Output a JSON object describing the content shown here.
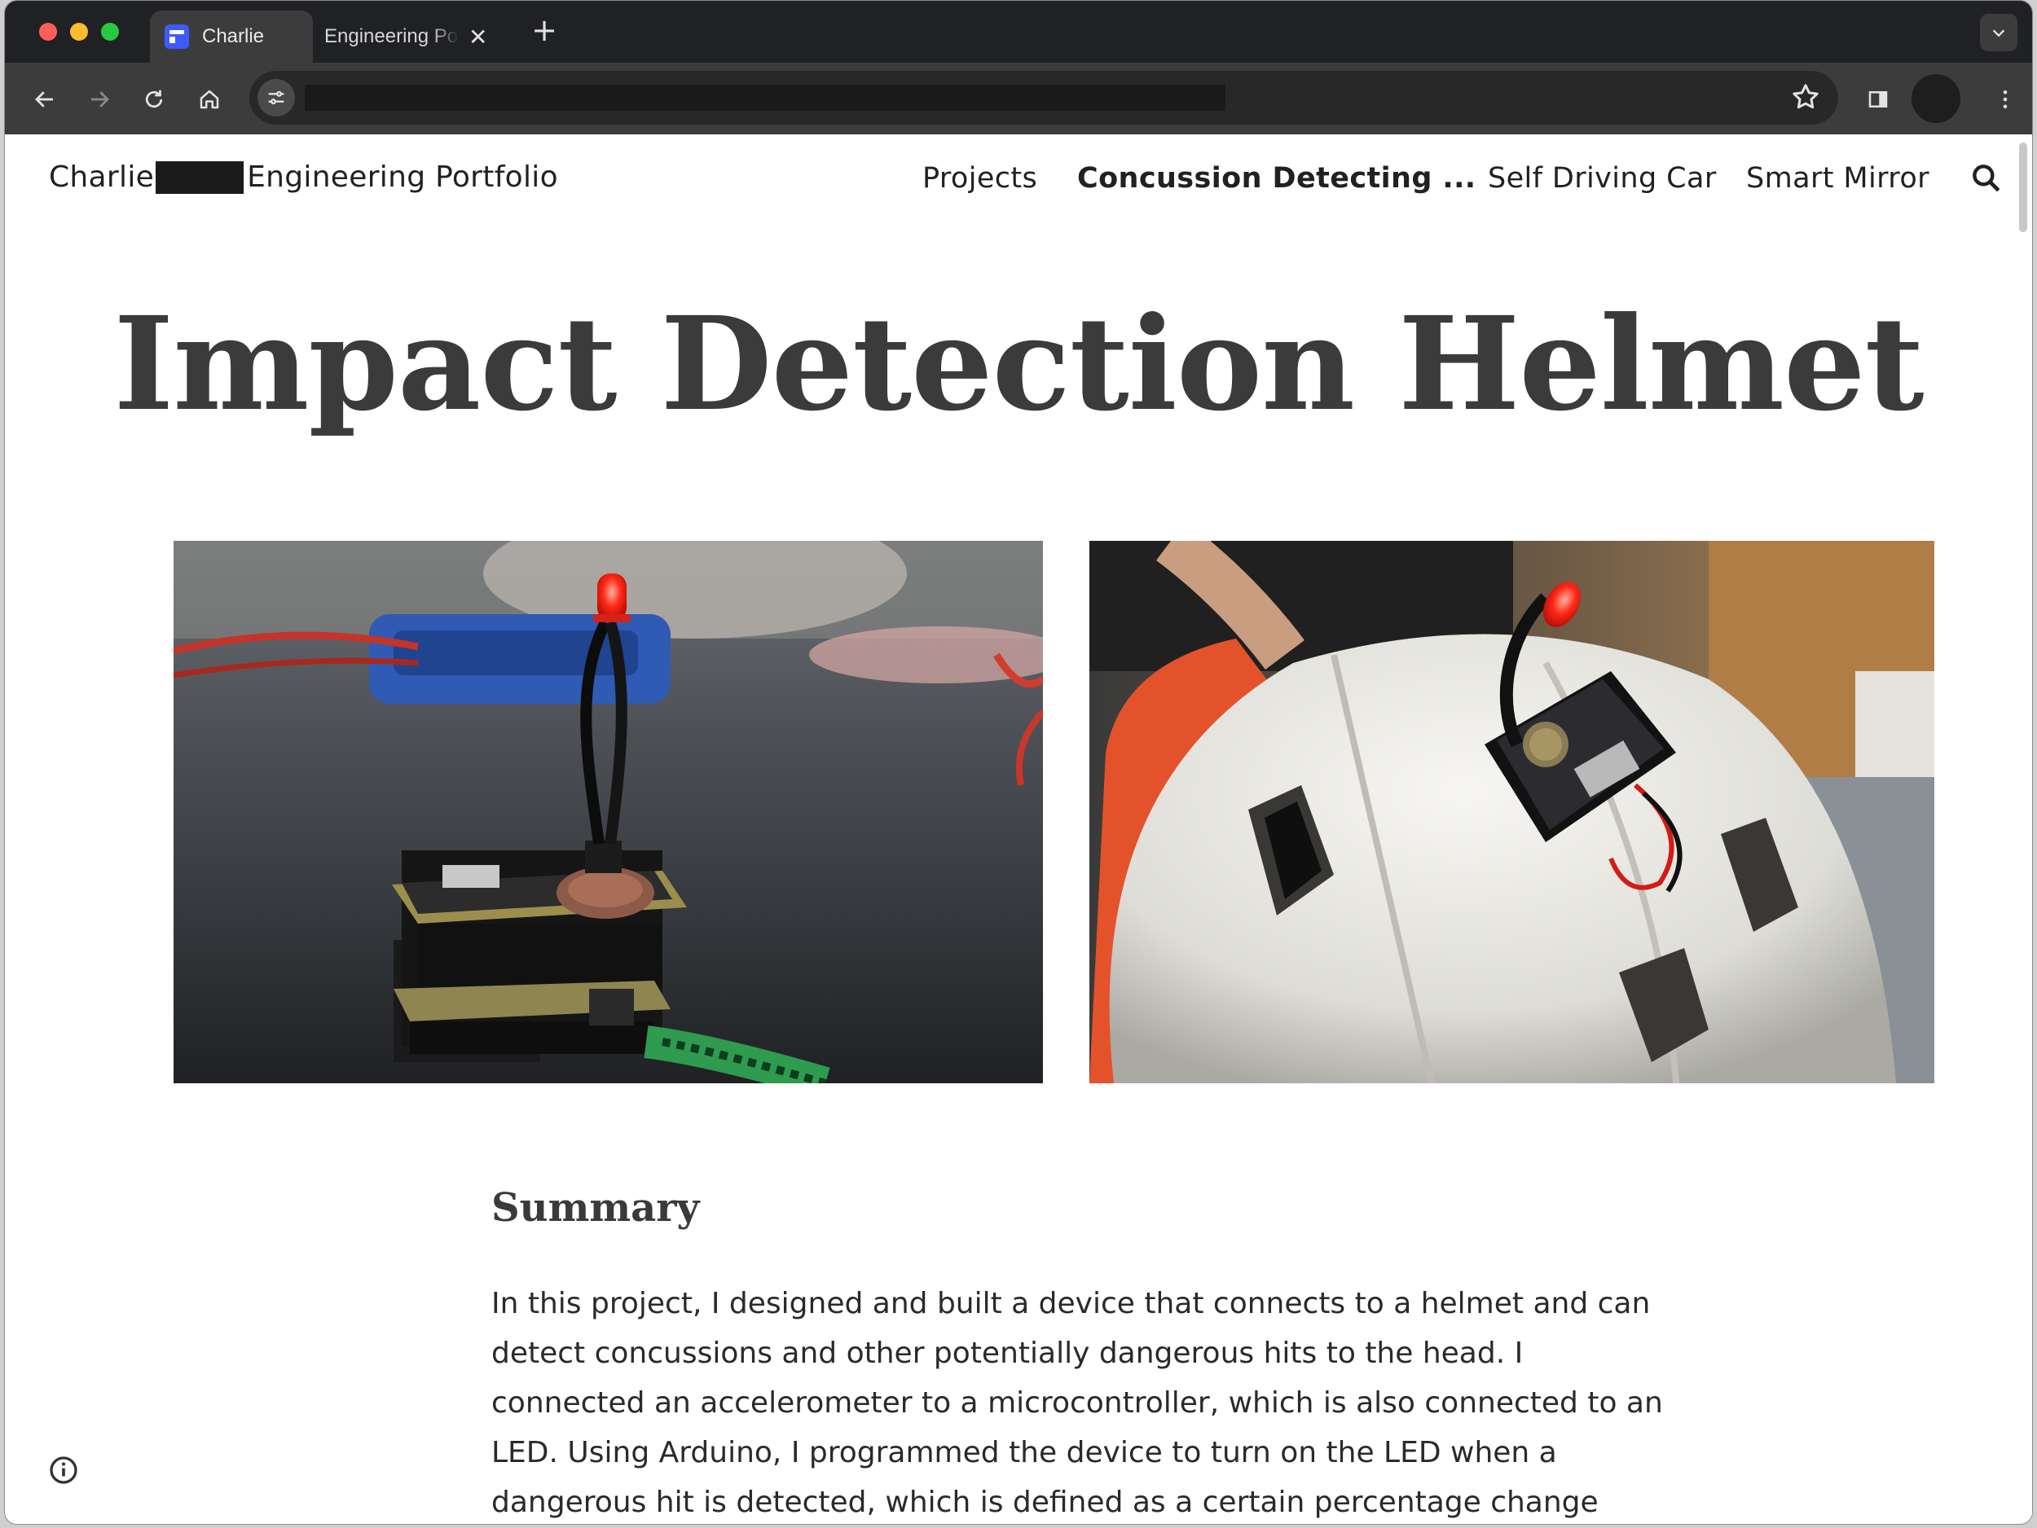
{
  "browser": {
    "tabs": [
      {
        "title": "Charlie",
        "active": true
      },
      {
        "title": "Engineering Portfolio",
        "active": false
      }
    ],
    "new_tab_label": "+",
    "close_glyph": "✕",
    "tabs_menu_glyph": "⌄"
  },
  "site": {
    "brand_first": "Charlie",
    "brand_rest": "Engineering Portfolio",
    "nav": [
      {
        "label": "Projects",
        "active": false
      },
      {
        "label": "Concussion Detecting ...",
        "active": true
      },
      {
        "label": "Self Driving Car",
        "active": false
      },
      {
        "label": "Smart Mirror",
        "active": false
      }
    ]
  },
  "main": {
    "title": "Impact Detection Helmet",
    "summary_heading": "Summary",
    "summary_body": "In this project, I designed and built a device that connects to a helmet and can detect concussions and other potentially dangerous hits to the head. I connected an accelerometer to a microcontroller, which is also connected to an LED. Using Arduino, I programmed the device to turn on the LED when a dangerous hit is detected, which is defined as a certain percentage change"
  },
  "icons": {
    "back": "arrow-left-icon",
    "forward": "arrow-right-icon",
    "reload": "reload-icon",
    "home": "home-icon",
    "site_info": "tune-icon",
    "bookmark": "star-icon",
    "side_panel": "side-panel-icon",
    "menu": "more-vert-icon",
    "search": "search-icon",
    "info": "info-icon"
  },
  "colors": {
    "titlebar": "#202124",
    "toolbar": "#3c3c3c",
    "accent_led": "#ff2a1a",
    "favicon": "#3d5afe"
  }
}
